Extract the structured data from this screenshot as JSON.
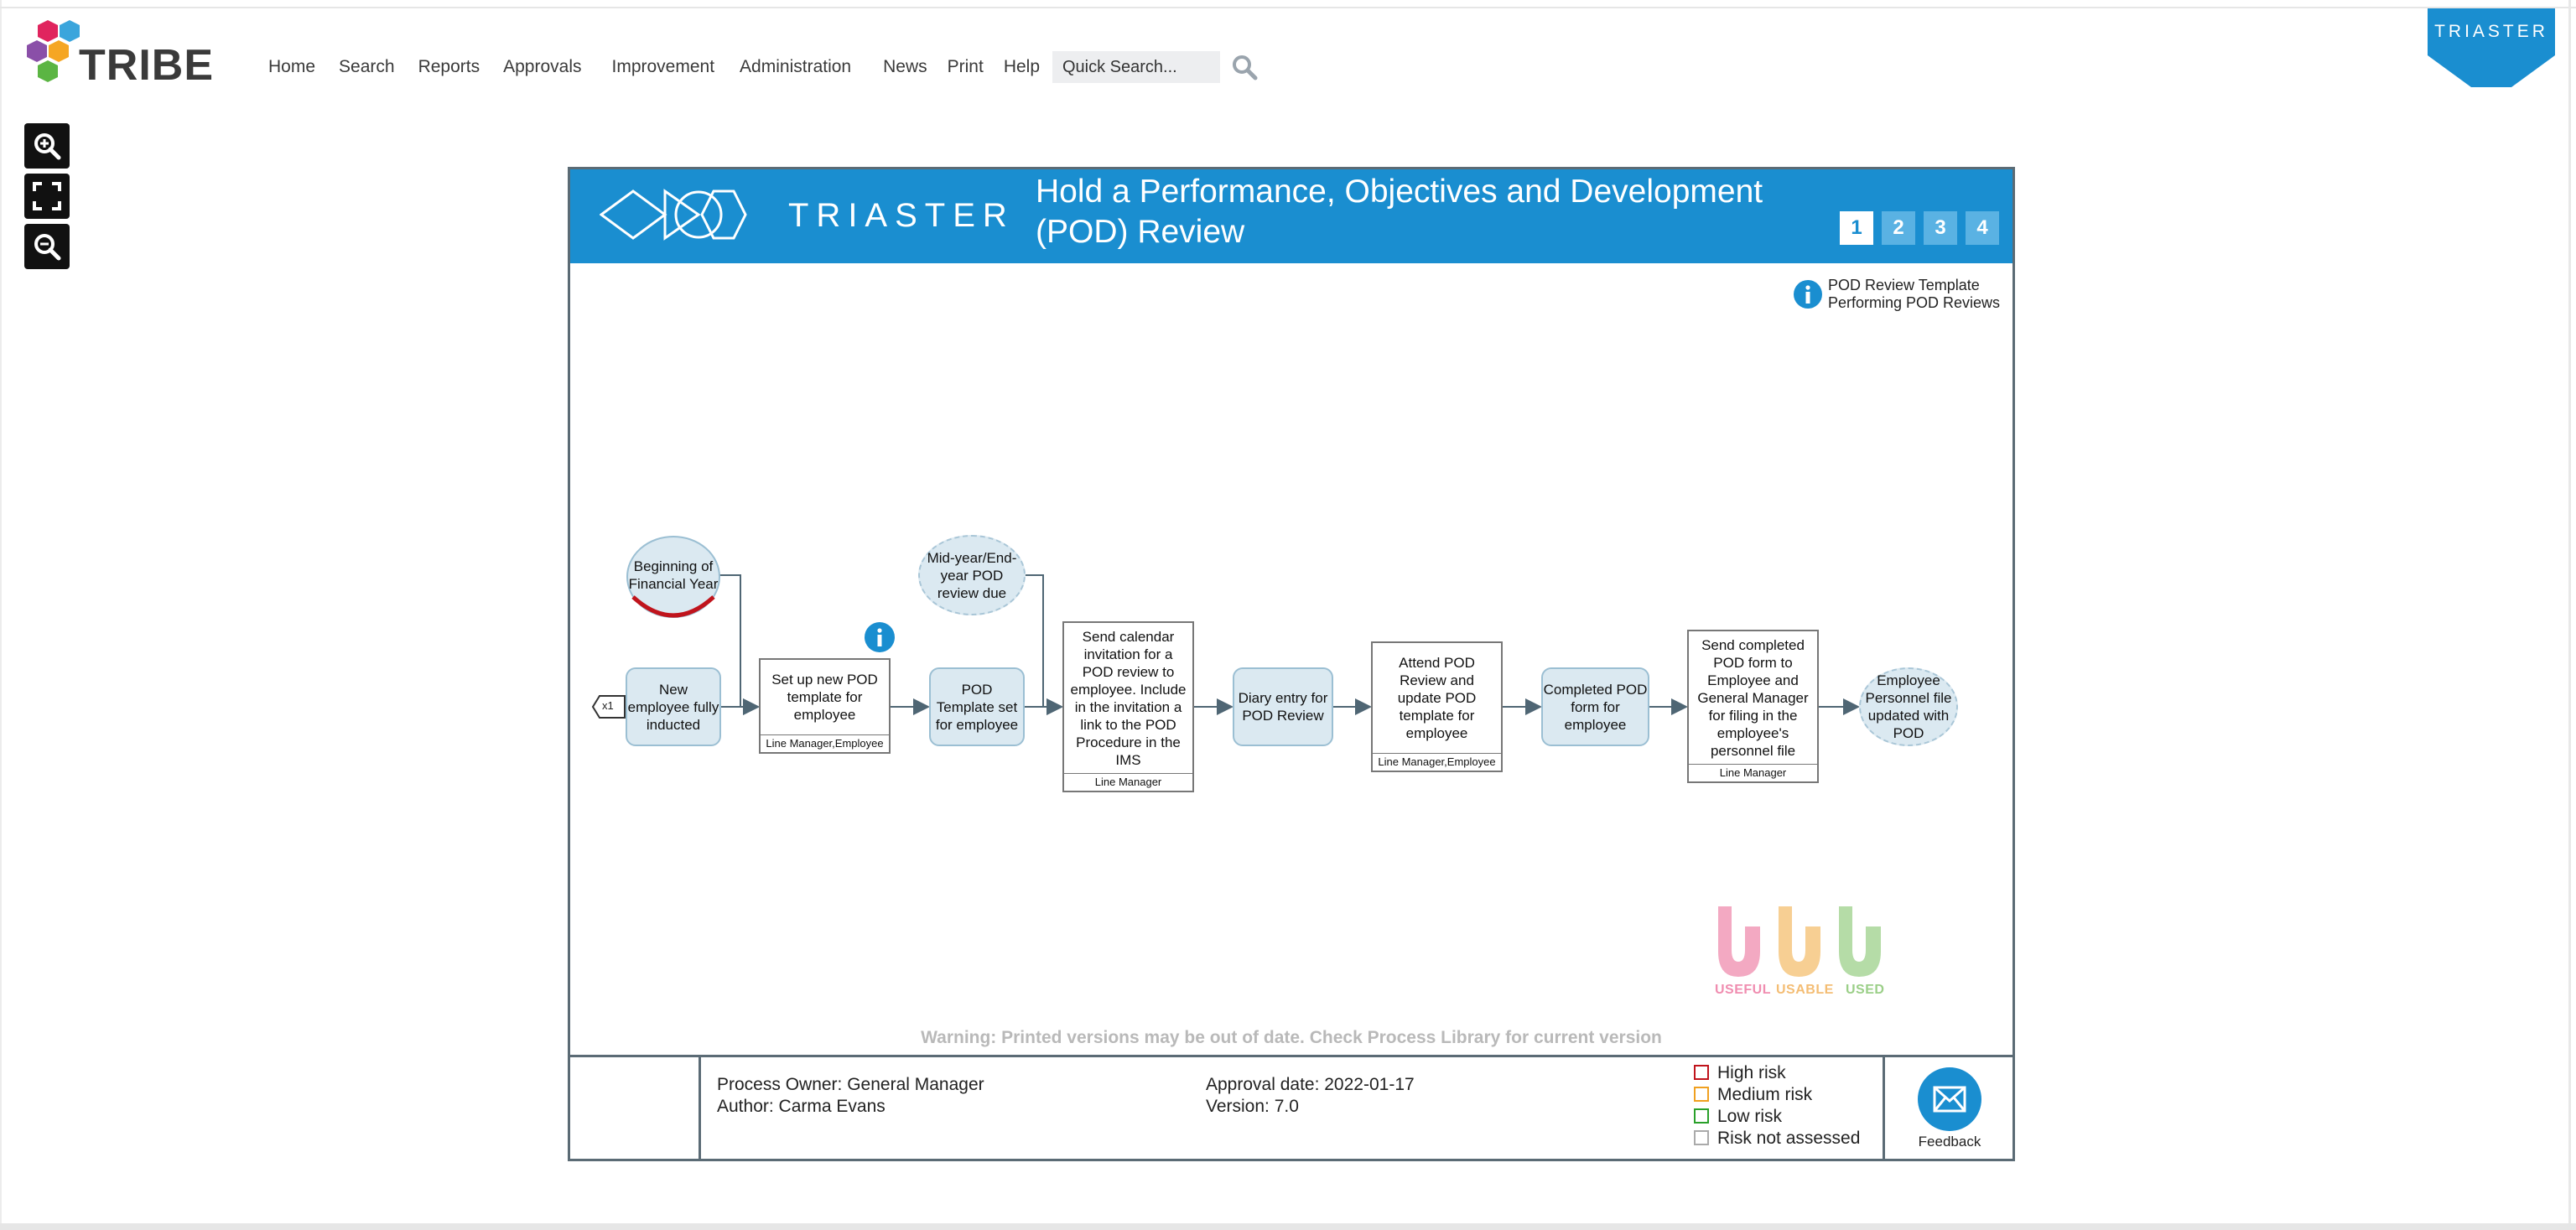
{
  "brand": {
    "name": "TRIBE",
    "badge": "TRIASTER"
  },
  "nav": [
    "Home",
    "Search",
    "Reports",
    "Approvals",
    "Improvement",
    "Administration",
    "News",
    "Print",
    "Help"
  ],
  "search": {
    "placeholder": "Quick Search..."
  },
  "diagram": {
    "banner_logo": "TRIASTER",
    "title": "Hold a Performance, Objectives and Development (POD) Review",
    "pages": [
      "1",
      "2",
      "3",
      "4"
    ],
    "active_page": "1",
    "info_links": [
      "POD Review Template",
      "Performing POD Reviews"
    ],
    "trigger_marker": "x1",
    "nodes": {
      "begin_fy": "Beginning of Financial Year",
      "midyear": "Mid-year/End-year POD review due",
      "new_employee": "New employee fully inducted",
      "setup_template": "Set up new POD template for employee",
      "setup_template_role": "Line Manager,Employee",
      "template_set": "POD Template set for employee",
      "send_invite": "Send calendar invitation for a POD review to employee. Include in the invitation a link to the POD Procedure in the IMS",
      "send_invite_role": "Line Manager",
      "diary_entry": "Diary entry for POD Review",
      "attend_review": "Attend POD Review and update POD template for employee",
      "attend_review_role": "Line Manager,Employee",
      "completed_form": "Completed POD form for employee",
      "send_completed": "Send completed POD form to Employee and General Manager for filing in the employee's personnel file",
      "send_completed_role": "Line Manager",
      "personnel_file": "Employee Personnel file updated with POD"
    },
    "uuu": [
      "USEFUL",
      "USABLE",
      "USED"
    ],
    "warning": "Warning: Printed versions may be out of date. Check Process Library for current version"
  },
  "footer": {
    "owner": "Process Owner: General Manager",
    "author": "Author: Carma Evans",
    "approval": "Approval date: 2022-01-17",
    "version": "Version: 7.0",
    "risks": [
      {
        "label": "High risk",
        "color": "#c0141c"
      },
      {
        "label": "Medium risk",
        "color": "#f0a020"
      },
      {
        "label": "Low risk",
        "color": "#2aa02a"
      },
      {
        "label": "Risk not assessed",
        "color": "#aaaaaa"
      }
    ],
    "feedback": "Feedback"
  },
  "colors": {
    "accent": "#1a8ed0",
    "frame": "#5b6b75",
    "event_fill": "#dbe9f1"
  }
}
